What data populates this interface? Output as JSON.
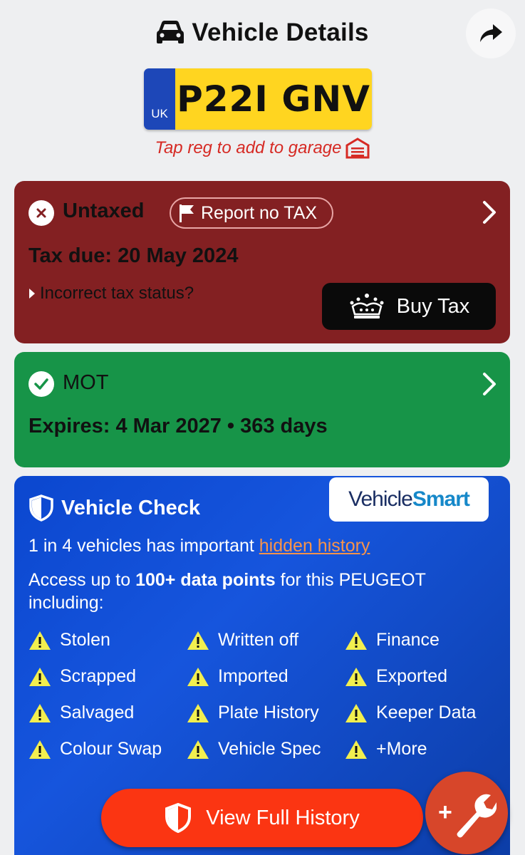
{
  "header": {
    "title": "Vehicle Details",
    "title_icon": "car-icon",
    "share_icon": "share-arrow-icon"
  },
  "plate": {
    "country": "UK",
    "registration": "P22I GNV",
    "colors": {
      "band": "#1d47b8",
      "plate": "#ffd520"
    }
  },
  "garage_hint": {
    "text": "Tap reg to add to garage",
    "icon": "garage-icon",
    "color": "#d62a24"
  },
  "tax": {
    "status": "Untaxed",
    "status_icon": "x-circle-icon",
    "report_label": "Report no TAX",
    "due": "Tax due: 20 May 2024",
    "incorrect_label": "Incorrect tax status?",
    "buy_label": "Buy Tax",
    "buy_icon": "crown-icon",
    "color": "#832022"
  },
  "mot": {
    "label": "MOT",
    "status_icon": "check-circle-icon",
    "expiry": "Expires: 4 Mar 2027 • 363 days",
    "color": "#179448"
  },
  "vehicle_check": {
    "title": "Vehicle Check",
    "logo_part1": "Vehicle",
    "logo_part2": "Smart",
    "hidden_prefix": "1 in 4 vehicles has important ",
    "hidden_link": "hidden history",
    "access_prefix": "Access up to ",
    "access_bold": "100+ data points",
    "access_suffix": " for this PEUGEOT including:",
    "features": [
      "Stolen",
      "Written off",
      "Finance",
      "Scrapped",
      "Imported",
      "Exported",
      "Salvaged",
      "Plate History",
      "Keeper Data",
      "Colour Swap",
      "Vehicle Spec",
      "+More"
    ]
  },
  "cta": {
    "label": "View Full History",
    "icon": "shield-icon",
    "color": "#fb3512"
  },
  "fab": {
    "icon": "add-wrench-icon",
    "label": "+"
  }
}
